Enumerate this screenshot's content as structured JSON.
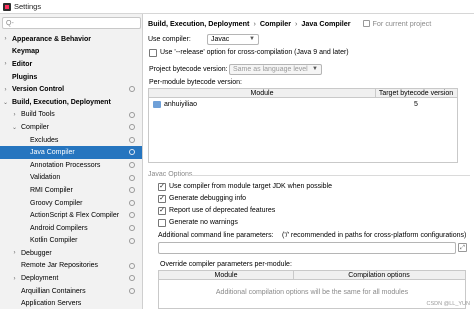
{
  "window": {
    "title": "Settings"
  },
  "sidebar": {
    "search_placeholder": "Q-",
    "items": [
      {
        "label": "Appearance & Behavior",
        "arrow": "›",
        "indent": 0,
        "bold": true
      },
      {
        "label": "Keymap",
        "arrow": "",
        "indent": 0,
        "bold": true
      },
      {
        "label": "Editor",
        "arrow": "›",
        "indent": 0,
        "bold": true
      },
      {
        "label": "Plugins",
        "arrow": "",
        "indent": 0,
        "bold": true
      },
      {
        "label": "Version Control",
        "arrow": "›",
        "indent": 0,
        "bold": true,
        "cfg": true
      },
      {
        "label": "Build, Execution, Deployment",
        "arrow": "⌄",
        "indent": 0,
        "bold": true
      },
      {
        "label": "Build Tools",
        "arrow": "›",
        "indent": 1,
        "cfg": true
      },
      {
        "label": "Compiler",
        "arrow": "⌄",
        "indent": 1,
        "cfg": true
      },
      {
        "label": "Excludes",
        "arrow": "",
        "indent": 2,
        "cfg": true
      },
      {
        "label": "Java Compiler",
        "arrow": "",
        "indent": 2,
        "cfg": true,
        "selected": true
      },
      {
        "label": "Annotation Processors",
        "arrow": "",
        "indent": 2,
        "cfg": true
      },
      {
        "label": "Validation",
        "arrow": "",
        "indent": 2,
        "cfg": true
      },
      {
        "label": "RMI Compiler",
        "arrow": "",
        "indent": 2,
        "cfg": true
      },
      {
        "label": "Groovy Compiler",
        "arrow": "",
        "indent": 2,
        "cfg": true
      },
      {
        "label": "ActionScript & Flex Compiler",
        "arrow": "",
        "indent": 2,
        "cfg": true
      },
      {
        "label": "Android Compilers",
        "arrow": "",
        "indent": 2,
        "cfg": true
      },
      {
        "label": "Kotlin Compiler",
        "arrow": "",
        "indent": 2,
        "cfg": true
      },
      {
        "label": "Debugger",
        "arrow": "›",
        "indent": 1
      },
      {
        "label": "Remote Jar Repositories",
        "arrow": "",
        "indent": 1,
        "cfg": true
      },
      {
        "label": "Deployment",
        "arrow": "›",
        "indent": 1,
        "cfg": true
      },
      {
        "label": "Arquillian Containers",
        "arrow": "",
        "indent": 1,
        "cfg": true
      },
      {
        "label": "Application Servers",
        "arrow": "",
        "indent": 1
      }
    ]
  },
  "breadcrumb": {
    "parts": [
      "Build, Execution, Deployment",
      "Compiler",
      "Java Compiler"
    ],
    "sep": "›",
    "scope": "For current project"
  },
  "compiler": {
    "use_compiler_label": "Use compiler:",
    "use_compiler_value": "Javac",
    "release_option_label": "Use '--release' option for cross-compilation (Java 9 and later)",
    "release_option_checked": false,
    "project_bytecode_label": "Project bytecode version:",
    "project_bytecode_value": "Same as language level",
    "per_module_label": "Per-module bytecode version:",
    "module_table": {
      "headers": [
        "Module",
        "Target bytecode version"
      ],
      "rows": [
        {
          "module": "anhuiyiliao",
          "target": "5"
        }
      ]
    }
  },
  "javac_options": {
    "section_title": "Javac Options",
    "checkboxes": [
      {
        "label": "Use compiler from module target JDK when possible",
        "checked": true
      },
      {
        "label": "Generate debugging info",
        "checked": true
      },
      {
        "label": "Report use of deprecated features",
        "checked": true
      },
      {
        "label": "Generate no warnings",
        "checked": false
      }
    ],
    "additional_params_label": "Additional command line parameters:",
    "additional_params_hint": "('/' recommended in paths for cross-platform configurations)",
    "override_label": "Override compiler parameters per-module:",
    "override_table": {
      "headers": [
        "Module",
        "Compilation options"
      ],
      "empty_text": "Additional compilation options will be the same for all modules"
    }
  },
  "watermark": "CSDN @LL_YUN"
}
